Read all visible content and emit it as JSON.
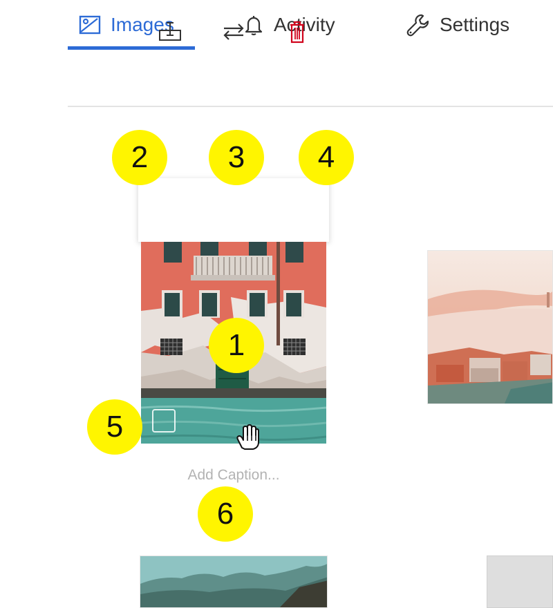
{
  "tabs": [
    {
      "label": "Images",
      "icon": "image-icon",
      "active": true
    },
    {
      "label": "Activity",
      "icon": "bell-icon",
      "active": false
    },
    {
      "label": "Settings",
      "icon": "wrench-icon",
      "active": false
    }
  ],
  "toolbar": {
    "buttons": [
      {
        "icon": "caption-icon"
      },
      {
        "icon": "replace-icon"
      },
      {
        "icon": "trash-icon"
      }
    ]
  },
  "caption": {
    "placeholder": "Add Caption..."
  },
  "markers": [
    "1",
    "2",
    "3",
    "4",
    "5",
    "6"
  ],
  "colors": {
    "accent": "#2d6bd6",
    "marker": "#fff500",
    "delete": "#d0021b",
    "divider": "#e3e3e3"
  }
}
